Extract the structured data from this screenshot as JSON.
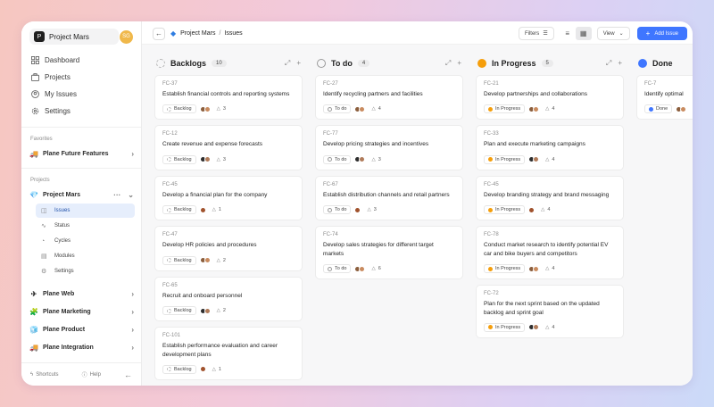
{
  "workspace": {
    "name": "Project Mars",
    "logo_letter": "P",
    "user_initials": "SG"
  },
  "nav": [
    {
      "label": "Dashboard",
      "icon": "grid-icon"
    },
    {
      "label": "Projects",
      "icon": "briefcase-icon"
    },
    {
      "label": "My Issues",
      "icon": "user-circle-icon"
    },
    {
      "label": "Settings",
      "icon": "gear-icon"
    }
  ],
  "favorites": {
    "label": "Favorites",
    "items": [
      {
        "label": "Plane Future Features",
        "emoji": "🚚"
      }
    ]
  },
  "projects": {
    "label": "Projects",
    "current": {
      "label": "Project Mars",
      "emoji": "💎"
    },
    "sub_items": [
      {
        "label": "Issues",
        "glyph": "◫"
      },
      {
        "label": "Status",
        "glyph": "∿"
      },
      {
        "label": "Cycles",
        "glyph": "◔"
      },
      {
        "label": "Modules",
        "glyph": "▤"
      },
      {
        "label": "Settings",
        "glyph": "⚙"
      }
    ],
    "others": [
      {
        "label": "Plane Web",
        "emoji": "✈"
      },
      {
        "label": "Plane Marketing",
        "emoji": "🧩"
      },
      {
        "label": "Plane Product",
        "emoji": "🧊"
      },
      {
        "label": "Plane Integration",
        "emoji": "🚚"
      }
    ]
  },
  "footer": {
    "shortcuts": "Shortcuts",
    "help": "Help"
  },
  "breadcrumb": {
    "project": "Project Mars",
    "separator": "/",
    "page": "Issues"
  },
  "toolbar": {
    "filters": "Filters",
    "view": "View",
    "add_issue": "Add Issue"
  },
  "colors": {
    "accent": "#3f76ff",
    "backlog": "#b5b5b5",
    "todo": "#9a9a9a",
    "in_progress": "#f59e0b",
    "done": "#3f76ff"
  },
  "columns": [
    {
      "title": "Backlogs",
      "count": "10",
      "state_color": "#b5b5b5",
      "cards": [
        {
          "id": "FC-37",
          "title": "Establish financial controls and reporting systems",
          "state": "Backlog",
          "estimate": "3"
        },
        {
          "id": "FC-12",
          "title": "Create revenue and expense forecasts",
          "state": "Backlog",
          "estimate": "3"
        },
        {
          "id": "FC-45",
          "title": "Develop a financial plan for the company",
          "state": "Backlog",
          "estimate": "1"
        },
        {
          "id": "FC-47",
          "title": "Develop HR policies and procedures",
          "state": "Backlog",
          "estimate": "2"
        },
        {
          "id": "FC-65",
          "title": "Recruit and onboard personnel",
          "state": "Backlog",
          "estimate": "2"
        },
        {
          "id": "FC-101",
          "title": "Establish performance evaluation and career development plans",
          "state": "Backlog",
          "estimate": "1"
        }
      ]
    },
    {
      "title": "To do",
      "count": "4",
      "state_color": "#9a9a9a",
      "cards": [
        {
          "id": "FC-27",
          "title": "Identify recycling partners and facilities",
          "state": "To do",
          "estimate": "4"
        },
        {
          "id": "FC-77",
          "title": "Develop pricing strategies and incentives",
          "state": "To do",
          "estimate": "3"
        },
        {
          "id": "FC-67",
          "title": "Establish distribution channels and retail partners",
          "state": "To do",
          "estimate": "3"
        },
        {
          "id": "FC-74",
          "title": "Develop sales strategies for different target markets",
          "state": "To do",
          "estimate": "6"
        }
      ]
    },
    {
      "title": "In Progress",
      "count": "5",
      "state_color": "#f59e0b",
      "cards": [
        {
          "id": "FC-21",
          "title": "Develop partnerships and collaborations",
          "state": "In Progress",
          "estimate": "4"
        },
        {
          "id": "FC-33",
          "title": "Plan and execute marketing campaigns",
          "state": "In Progress",
          "estimate": "4"
        },
        {
          "id": "FC-45",
          "title": "Develop branding strategy and brand messaging",
          "state": "In Progress",
          "estimate": "4"
        },
        {
          "id": "FC-78",
          "title": "Conduct market research to identify potential EV car and bike buyers and competitors",
          "state": "In Progress",
          "estimate": "4"
        },
        {
          "id": "FC-72",
          "title": "Plan for the next sprint based on the updated backlog and sprint goal",
          "state": "In Progress",
          "estimate": "4"
        }
      ]
    },
    {
      "title": "Done",
      "count": "",
      "state_color": "#3f76ff",
      "cards": [
        {
          "id": "FC-7",
          "title": "Identify optimal",
          "state": "Done",
          "estimate": ""
        }
      ]
    }
  ]
}
